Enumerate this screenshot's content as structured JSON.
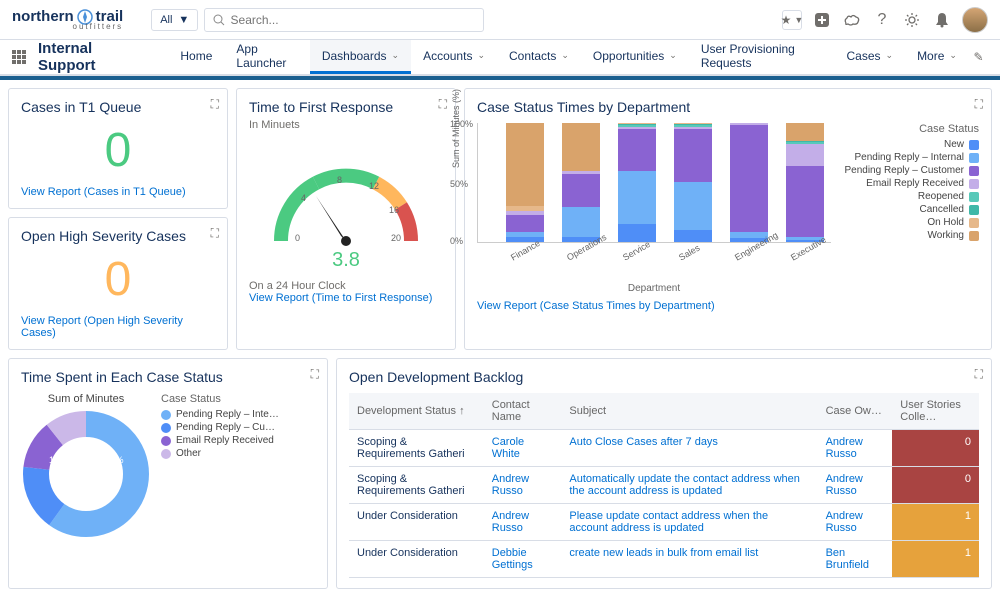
{
  "brand": {
    "name": "northern",
    "name2": "trail",
    "sub": "outfitters"
  },
  "search": {
    "all": "All",
    "placeholder": "Search..."
  },
  "app": {
    "name": "Internal Support"
  },
  "nav": [
    {
      "label": "Home",
      "chev": false
    },
    {
      "label": "App Launcher",
      "chev": false
    },
    {
      "label": "Dashboards",
      "chev": true,
      "active": true
    },
    {
      "label": "Accounts",
      "chev": true
    },
    {
      "label": "Contacts",
      "chev": true
    },
    {
      "label": "Opportunities",
      "chev": true
    },
    {
      "label": "User Provisioning Requests",
      "chev": false
    },
    {
      "label": "Cases",
      "chev": true
    },
    {
      "label": "More",
      "chev": true
    }
  ],
  "cards": {
    "t1": {
      "title": "Cases in T1 Queue",
      "value": "0",
      "link": "View Report (Cases in T1 Queue)"
    },
    "hs": {
      "title": "Open High Severity Cases",
      "value": "0",
      "link": "View Report (Open High Severity Cases)"
    },
    "gauge": {
      "title": "Time to First Response",
      "sub": "In Minuets",
      "value": "3.8",
      "note": "On a 24 Hour Clock",
      "link": "View Report (Time to First Response)"
    },
    "dept": {
      "title": "Case Status Times by Department",
      "legend_title": "Case Status",
      "xlabel": "Department",
      "ylabel": "Sum of Minutes (%)",
      "link": "View Report (Case Status Times by Department)"
    },
    "donut": {
      "title": "Time Spent in Each Case Status",
      "chart_title": "Sum of Minutes",
      "legend_title": "Case Status",
      "pct1": "10.28%",
      "pct2": "12.41%"
    },
    "backlog": {
      "title": "Open Development Backlog"
    }
  },
  "colors": {
    "new": "#4f8ef7",
    "pending_internal": "#6fb1f7",
    "pending_customer": "#8a63d2",
    "email_reply": "#c3aee8",
    "reopened": "#58c9b9",
    "cancelled": "#3fb8a8",
    "on_hold": "#e6b88a",
    "working": "#d9a36b",
    "other": "#cbb8e8"
  },
  "dept_legend": [
    "New",
    "Pending Reply – Internal",
    "Pending Reply – Customer",
    "Email Reply Received",
    "Reopened",
    "Cancelled",
    "On Hold",
    "Working"
  ],
  "donut_legend": [
    "Pending Reply – Inte…",
    "Pending Reply – Cu…",
    "Email Reply Received",
    "Other"
  ],
  "chart_data": {
    "gauge": {
      "type": "gauge",
      "value": 3.8,
      "ticks": [
        0,
        4,
        8,
        12,
        16,
        20
      ],
      "range": [
        0,
        20
      ]
    },
    "dept": {
      "type": "bar",
      "stacked_pct": true,
      "ylim": [
        0,
        100
      ],
      "yticks": [
        0,
        50,
        100
      ],
      "categories": [
        "Finance",
        "Operations",
        "Service",
        "Sales",
        "Engineering",
        "Executive"
      ],
      "series": [
        {
          "name": "New",
          "values": [
            4,
            4,
            15,
            10,
            3,
            2
          ]
        },
        {
          "name": "Pending Reply – Internal",
          "values": [
            4,
            25,
            45,
            40,
            5,
            2
          ]
        },
        {
          "name": "Pending Reply – Customer",
          "values": [
            15,
            28,
            35,
            45,
            90,
            60
          ]
        },
        {
          "name": "Email Reply Received",
          "values": [
            3,
            3,
            2,
            2,
            2,
            18
          ]
        },
        {
          "name": "Reopened",
          "values": [
            0,
            0,
            1,
            1,
            0,
            2
          ]
        },
        {
          "name": "Cancelled",
          "values": [
            0,
            0,
            1,
            1,
            0,
            1
          ]
        },
        {
          "name": "On Hold",
          "values": [
            4,
            0,
            1,
            1,
            0,
            0
          ]
        },
        {
          "name": "Working",
          "values": [
            70,
            40,
            0,
            0,
            0,
            15
          ]
        }
      ]
    },
    "donut": {
      "type": "pie",
      "series": [
        {
          "name": "Pending Reply – Internal",
          "value": 60
        },
        {
          "name": "Pending Reply – Customer",
          "value": 17
        },
        {
          "name": "Email Reply Received",
          "value": 12.41
        },
        {
          "name": "Other",
          "value": 10.28
        }
      ]
    }
  },
  "table": {
    "cols": [
      "Development Status ↑",
      "Contact Name",
      "Subject",
      "Case Ow…",
      "User Stories Colle…"
    ],
    "rows": [
      {
        "status": "Scoping & Requirements Gatheri",
        "contact": "Carole White",
        "subject": "Auto Close Cases after 7 days",
        "owner": "Andrew Russo",
        "count": "0",
        "cls": "badge-red"
      },
      {
        "status": "Scoping & Requirements Gatheri",
        "contact": "Andrew Russo",
        "subject": "Automatically update the contact address when the account address is updated",
        "owner": "Andrew Russo",
        "count": "0",
        "cls": "badge-red"
      },
      {
        "status": "Under Consideration",
        "contact": "Andrew Russo",
        "subject": "Please update contact address when the account address is updated",
        "owner": "Andrew Russo",
        "count": "1",
        "cls": "badge-amber"
      },
      {
        "status": "Under Consideration",
        "contact": "Debbie Gettings",
        "subject": "create new leads in bulk from email list",
        "owner": "Ben Brunfield",
        "count": "1",
        "cls": "badge-amber"
      }
    ]
  }
}
